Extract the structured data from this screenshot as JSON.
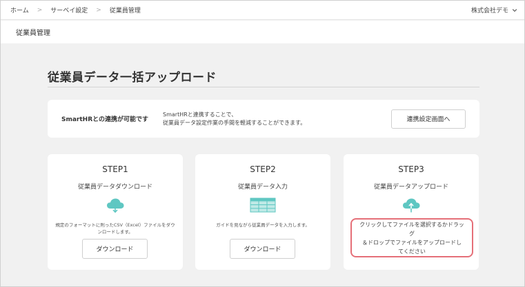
{
  "breadcrumb": {
    "items": [
      "ホーム",
      "サーベイ設定",
      "従業員管理"
    ],
    "separator": ">"
  },
  "company": {
    "name": "株式会社デモ",
    "icon": "chevron-down-icon"
  },
  "subheader": {
    "title": "従業員管理"
  },
  "page": {
    "title": "従業員データ一括アップロード"
  },
  "banner": {
    "title": "SmartHRとの連携が可能です",
    "description_line1": "SmartHRと連携することで、",
    "description_line2": "従業員データ設定作業の手間を軽減することができます。",
    "button_label": "連携設定画面へ"
  },
  "steps": [
    {
      "title": "STEP1",
      "subtitle": "従業員データダウンロード",
      "icon": "cloud-download-icon",
      "note_line1": "規定のフォーマットに則ったCSV（Excel）ファイルをダウ",
      "note_line2": "ンロードします。",
      "button_label": "ダウンロード"
    },
    {
      "title": "STEP2",
      "subtitle": "従業員データ入力",
      "icon": "spreadsheet-icon",
      "note_line1": "ガイドを見ながら従業員データを入力します。",
      "button_label": "ダウンロード"
    },
    {
      "title": "STEP3",
      "subtitle": "従業員データアップロード",
      "icon": "cloud-upload-icon",
      "dropzone_line1": "クリックしてファイルを選択するかドラッグ",
      "dropzone_line2": "＆ドロップでファイルをアップロードし",
      "dropzone_line3": "てください"
    }
  ],
  "colors": {
    "accent_teal": "#5fc7c2",
    "dropzone_border": "#e56f78",
    "background": "#f1f1f1"
  }
}
